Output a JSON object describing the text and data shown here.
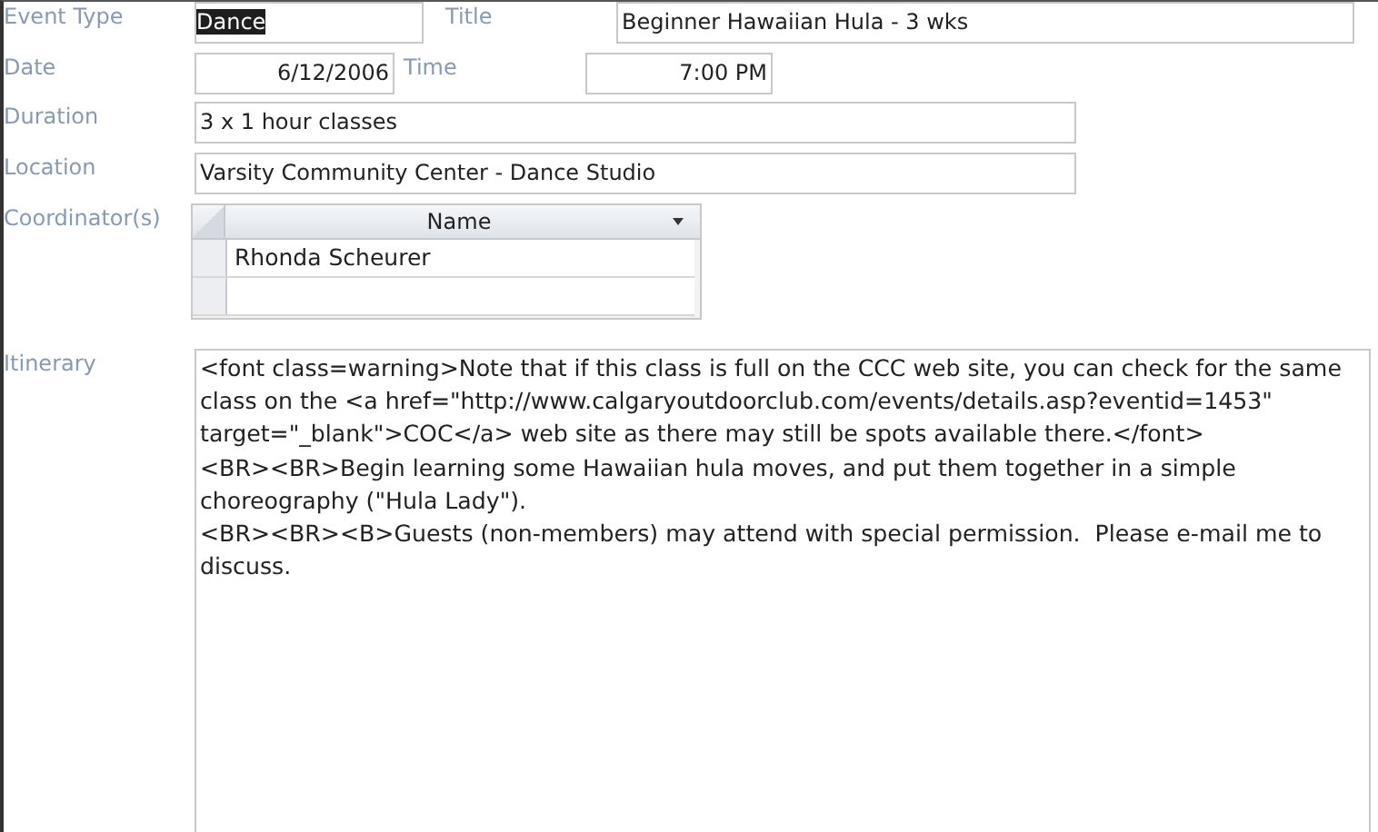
{
  "event_type": {
    "label": "Event Type",
    "value": "Dance",
    "highlighted": true
  },
  "title": {
    "label": "Title",
    "value": "Beginner Hawaiian Hula - 3 wks"
  },
  "date": {
    "label": "Date",
    "value": "6/12/2006"
  },
  "time": {
    "label": "Time",
    "value": "7:00 PM"
  },
  "duration": {
    "label": "Duration",
    "value": "3 x 1 hour classes"
  },
  "location": {
    "label": "Location",
    "value": "Varsity Community Center - Dance Studio"
  },
  "coordinators": {
    "label": "Coordinator(s)",
    "column": "Name",
    "rows": [
      "Rhonda Scheurer"
    ]
  },
  "itinerary": {
    "label": "Itinerary",
    "value": "<font class=warning>Note that if this class is full on the CCC web site, you can check for the same class on the <a href=\"http://www.calgaryoutdoorclub.com/events/details.asp?eventid=1453\" target=\"_blank\">COC</a> web site as there may still be spots available there.</font>\n<BR><BR>Begin learning some Hawaiian hula moves, and put them together in a simple choreography (\"Hula Lady\").\n<BR><BR><B>Guests (non-members) may attend with special permission.  Please e-mail me to discuss."
  }
}
